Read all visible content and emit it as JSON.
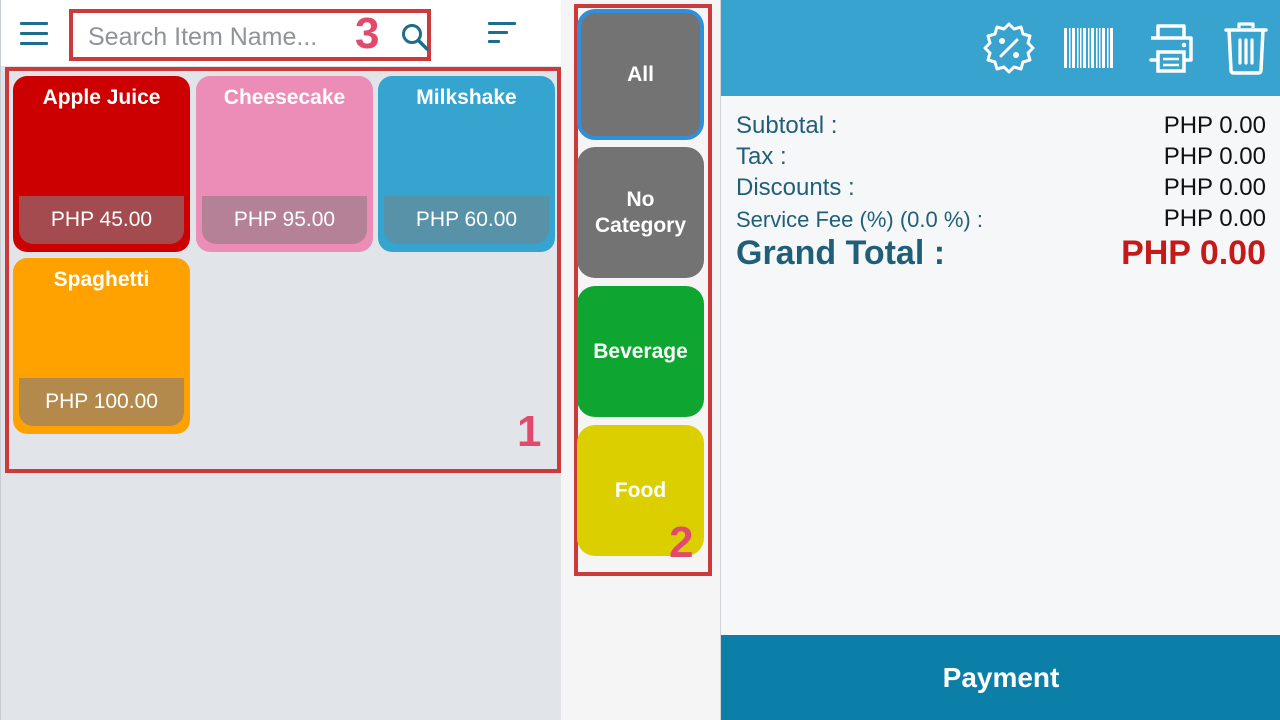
{
  "search": {
    "placeholder": "Search Item Name..."
  },
  "region_numbers": [
    "1",
    "2",
    "3"
  ],
  "items": [
    {
      "name": "Apple Juice",
      "price": "PHP 45.00",
      "color": "#cc0000",
      "band": "#a44b4f"
    },
    {
      "name": "Cheesecake",
      "price": "PHP 95.00",
      "color": "#ec8db8",
      "band": "#b58196"
    },
    {
      "name": "Milkshake",
      "price": "PHP 60.00",
      "color": "#35a5cf",
      "band": "#5892a9"
    },
    {
      "name": "Spaghetti",
      "price": "PHP 100.00",
      "color": "#ffa200",
      "band": "#b38a4b"
    }
  ],
  "categories": [
    {
      "label": "All",
      "color": "#737373",
      "selected": true
    },
    {
      "label": "No Category",
      "color": "#737373",
      "selected": false
    },
    {
      "label": "Beverage",
      "color": "#0ea630",
      "selected": false
    },
    {
      "label": "Food",
      "color": "#dccf00",
      "selected": false
    }
  ],
  "header_icons": [
    "discount-badge-icon",
    "barcode-icon",
    "printer-icon",
    "trash-icon"
  ],
  "summary": {
    "subtotal_label": "Subtotal :",
    "subtotal_value": "PHP 0.00",
    "tax_label": "Tax :",
    "tax_value": "PHP 0.00",
    "discounts_label": "Discounts :",
    "discounts_value": "PHP 0.00",
    "service_fee_label": "Service Fee (%) (0.0 %) :",
    "service_fee_value": "PHP 0.00",
    "grand_total_label": "Grand Total :",
    "grand_total_value": "PHP 0.00"
  },
  "payment_label": "Payment",
  "colors": {
    "accent": "#38a3cf",
    "payment": "#0c7fa8",
    "grand_total": "#c51a1a",
    "annotation_box": "#cc3b3b",
    "annotation_number": "#e24a6d"
  }
}
